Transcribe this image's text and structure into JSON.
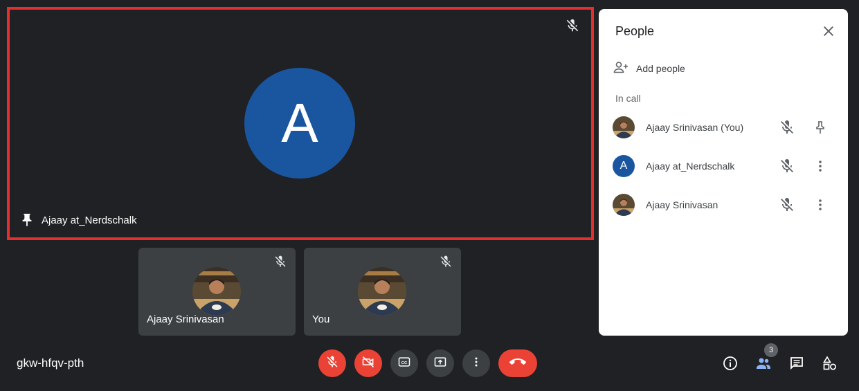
{
  "main_tile": {
    "avatar_letter": "A",
    "name": "Ajaay at_Nerdschalk",
    "pinned": true,
    "muted": true
  },
  "thumbnails": [
    {
      "name": "Ajaay Srinivasan",
      "muted": true
    },
    {
      "name": "You",
      "muted": true
    }
  ],
  "people_panel": {
    "title": "People",
    "add_people_label": "Add people",
    "section_label": "In call",
    "participants": [
      {
        "name": "Ajaay Srinivasan (You)",
        "avatar": "photo",
        "action_icon": "pin-icon"
      },
      {
        "name": "Ajaay at_Nerdschalk",
        "avatar_letter": "A",
        "action_icon": "more-vert-icon"
      },
      {
        "name": "Ajaay Srinivasan",
        "avatar": "photo",
        "action_icon": "more-vert-icon"
      }
    ]
  },
  "bottom_bar": {
    "meeting_code": "gkw-hfqv-pth",
    "people_count": "3",
    "controls": [
      "mic-off-icon",
      "camera-off-icon",
      "captions-icon",
      "present-screen-icon",
      "more-options-icon",
      "hang-up-icon"
    ],
    "right_icons": [
      "info-icon",
      "people-icon",
      "chat-icon",
      "activities-icon"
    ]
  },
  "colors": {
    "background": "#202124",
    "highlight_border": "#e52e2e",
    "avatar_blue": "#1a56a0",
    "danger_red": "#ea4335",
    "tile_grey": "#3c4043",
    "active_blue": "#8ab4f8"
  }
}
